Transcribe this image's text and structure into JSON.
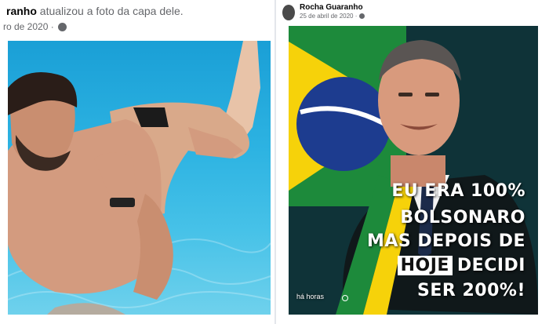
{
  "left_post": {
    "author": "ranho",
    "action": "atualizou a foto da capa dele.",
    "date": "ro de 2020 ·"
  },
  "right_post": {
    "author": "Rocha Guaranho",
    "date": "25 de abril de 2020 ·",
    "overlay_lines": [
      "EU ERA 100%",
      "BOLSONARO",
      "MAS DEPOIS DE",
      "HOJE",
      "DECIDI",
      "SER 200%!"
    ],
    "time_label": "há horas"
  },
  "icons": {
    "privacy": "globe-icon"
  },
  "colors": {
    "meta_text": "#65676b",
    "pool": "#2db3e2",
    "flag_green": "#1d8a3b",
    "flag_yellow": "#f6d20a",
    "flag_blue": "#1d3c8f"
  }
}
